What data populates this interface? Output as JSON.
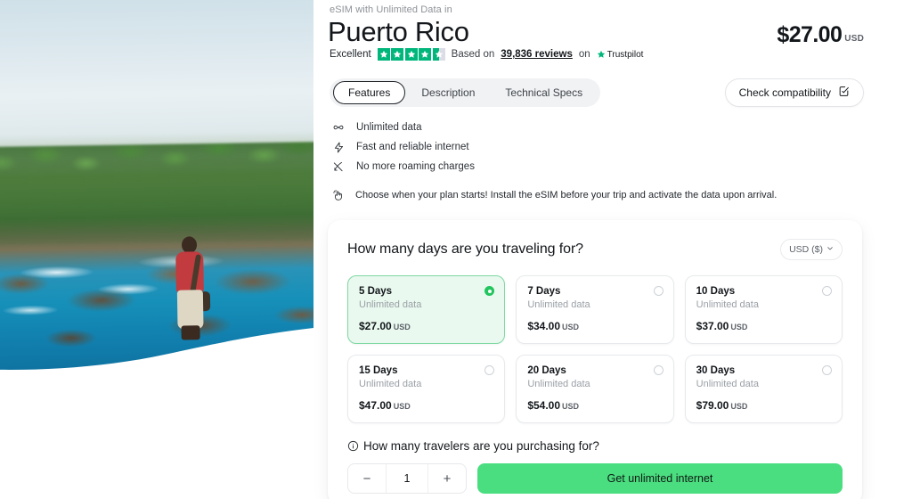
{
  "product": {
    "eyebrow": "eSIM with Unlimited Data in",
    "title": "Puerto Rico",
    "price_amount": "$27.00",
    "price_currency": "USD"
  },
  "rating": {
    "label": "Excellent",
    "stars_filled": 4,
    "stars_half": 1,
    "stars_total": 5,
    "star_color": "#00b67a",
    "based_on": "Based on",
    "reviews_count": "39,836 reviews",
    "on": "on",
    "brand": "Trustpilot"
  },
  "tabs": [
    {
      "label": "Features",
      "active": true
    },
    {
      "label": "Description",
      "active": false
    },
    {
      "label": "Technical Specs",
      "active": false
    }
  ],
  "compatibility": {
    "label": "Check compatibility",
    "icon": "clipboard-check-icon"
  },
  "features": [
    {
      "icon": "infinity-icon",
      "label": "Unlimited data"
    },
    {
      "icon": "lightning-bolt-icon",
      "label": "Fast and reliable internet"
    },
    {
      "icon": "no-roaming-icon",
      "label": "No more roaming charges"
    }
  ],
  "note": {
    "icon": "tap-hand-icon",
    "text": "Choose when your plan starts! Install the eSIM before your trip and activate the data upon arrival."
  },
  "selector": {
    "title": "How many days are you traveling for?",
    "currency_label": "USD ($)",
    "currency_caret": "chevron-down-icon",
    "plans": [
      {
        "days": "5 Days",
        "data": "Unlimited data",
        "price": "$27.00",
        "currency": "USD",
        "selected": true
      },
      {
        "days": "7 Days",
        "data": "Unlimited data",
        "price": "$34.00",
        "currency": "USD",
        "selected": false
      },
      {
        "days": "10 Days",
        "data": "Unlimited data",
        "price": "$37.00",
        "currency": "USD",
        "selected": false
      },
      {
        "days": "15 Days",
        "data": "Unlimited data",
        "price": "$47.00",
        "currency": "USD",
        "selected": false
      },
      {
        "days": "20 Days",
        "data": "Unlimited data",
        "price": "$54.00",
        "currency": "USD",
        "selected": false
      },
      {
        "days": "30 Days",
        "data": "Unlimited data",
        "price": "$79.00",
        "currency": "USD",
        "selected": false
      }
    ],
    "travelers_question": "How many travelers are you purchasing for?",
    "travelers_info_icon": "info-circle-icon",
    "quantity": "1",
    "decrement_label": "−",
    "increment_label": "+",
    "cta_label": "Get unlimited internet",
    "cta_color": "#4ade80",
    "selected_plan_bg": "#e9f9ef",
    "selected_plan_border": "#7fd8a2"
  },
  "hero": {
    "alt": "Traveler standing on rocky coastline overlooking the ocean in Puerto Rico"
  }
}
